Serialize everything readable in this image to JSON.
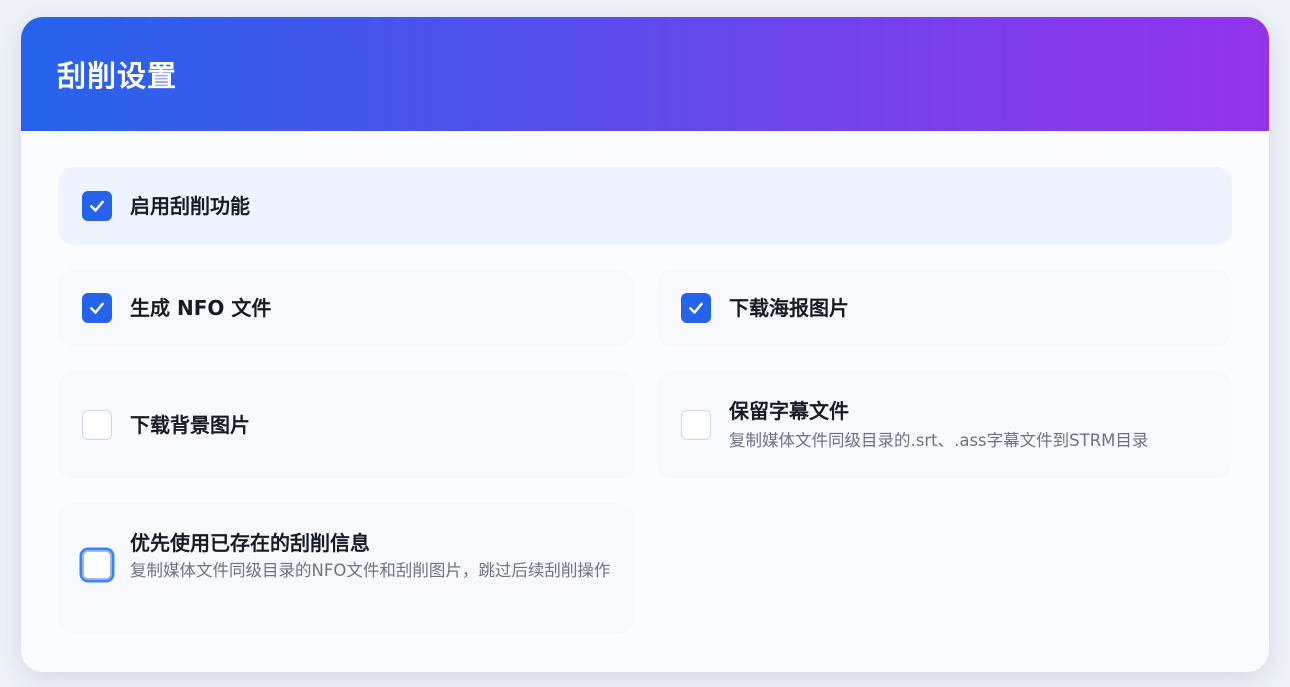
{
  "panel": {
    "title": "刮削设置"
  },
  "options": {
    "enable": {
      "label": "启用刮削功能",
      "checked": true
    },
    "nfo": {
      "label": "生成 NFO 文件",
      "checked": true
    },
    "poster": {
      "label": "下载海报图片",
      "checked": true
    },
    "backdrop": {
      "label": "下载背景图片",
      "checked": false
    },
    "subtitles": {
      "label": "保留字幕文件",
      "desc": "复制媒体文件同级目录的.srt、.ass字幕文件到STRM目录",
      "checked": false
    },
    "existing": {
      "label": "优先使用已存在的刮削信息",
      "desc": "复制媒体文件同级目录的NFO文件和刮削图片，跳过后续刮削操作",
      "checked": false
    }
  },
  "colors": {
    "accent": "#2563eb",
    "header_start": "#2563eb",
    "header_end": "#9333ea"
  },
  "icons": {
    "checked": "check-icon"
  }
}
